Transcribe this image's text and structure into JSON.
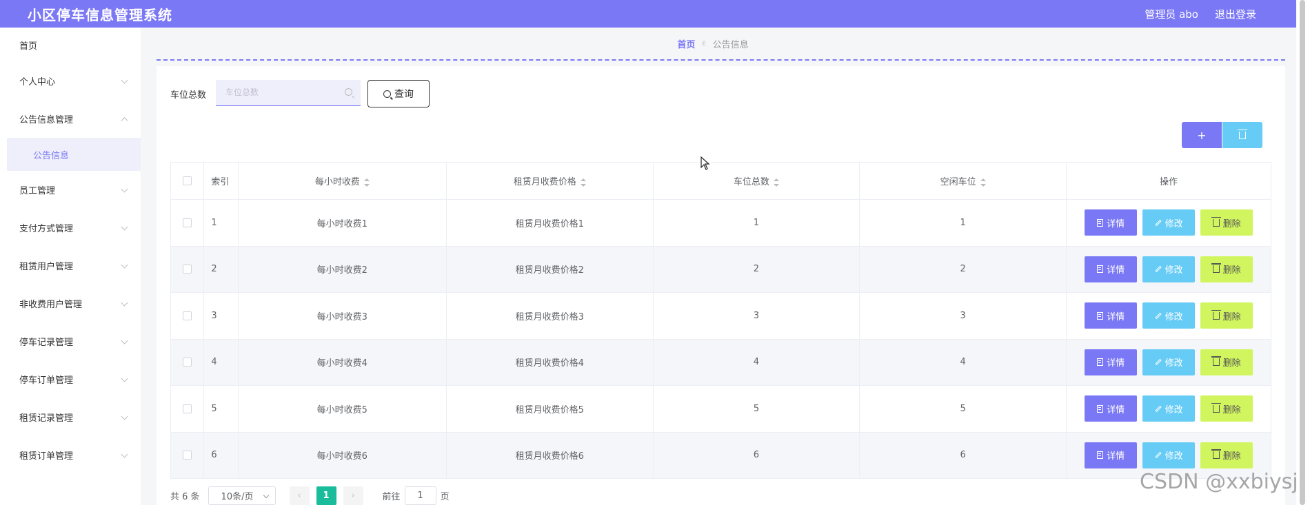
{
  "app": {
    "title": "小区停车信息管理系统",
    "admin_label": "管理员 abo",
    "logout_label": "退出登录"
  },
  "sidebar": {
    "items": [
      {
        "label": "首页"
      },
      {
        "label": "个人中心"
      },
      {
        "label": "公告信息管理",
        "expanded": true,
        "children": [
          {
            "label": "公告信息",
            "active": true
          }
        ]
      },
      {
        "label": "员工管理"
      },
      {
        "label": "支付方式管理"
      },
      {
        "label": "租赁用户管理"
      },
      {
        "label": "非收费用户管理"
      },
      {
        "label": "停车记录管理"
      },
      {
        "label": "停车订单管理"
      },
      {
        "label": "租赁记录管理"
      },
      {
        "label": "租赁订单管理"
      }
    ]
  },
  "breadcrumb": {
    "home": "首页",
    "current": "公告信息"
  },
  "search": {
    "label": "车位总数",
    "placeholder": "车位总数",
    "value": "",
    "button_label": "查询"
  },
  "toolbar": {
    "add_label": "+",
    "add_icon": "plus-icon",
    "delete_icon": "trash-icon"
  },
  "table": {
    "columns": [
      "索引",
      "每小时收费",
      "租赁月收费价格",
      "车位总数",
      "空闲车位",
      "操作"
    ],
    "rows": [
      {
        "index": "1",
        "hourly_fee": "每小时收费1",
        "monthly_price": "租赁月收费价格1",
        "total_spaces": "1",
        "free_spaces": "1"
      },
      {
        "index": "2",
        "hourly_fee": "每小时收费2",
        "monthly_price": "租赁月收费价格2",
        "total_spaces": "2",
        "free_spaces": "2"
      },
      {
        "index": "3",
        "hourly_fee": "每小时收费3",
        "monthly_price": "租赁月收费价格3",
        "total_spaces": "3",
        "free_spaces": "3"
      },
      {
        "index": "4",
        "hourly_fee": "每小时收费4",
        "monthly_price": "租赁月收费价格4",
        "total_spaces": "4",
        "free_spaces": "4"
      },
      {
        "index": "5",
        "hourly_fee": "每小时收费5",
        "monthly_price": "租赁月收费价格5",
        "total_spaces": "5",
        "free_spaces": "5"
      },
      {
        "index": "6",
        "hourly_fee": "每小时收费6",
        "monthly_price": "租赁月收费价格6",
        "total_spaces": "6",
        "free_spaces": "6"
      }
    ],
    "actions": {
      "detail": "详情",
      "edit": "修改",
      "delete": "删除"
    }
  },
  "pagination": {
    "total": "共 6 条",
    "page_size": "10条/页",
    "prev": "‹",
    "current_page": "1",
    "next": "›",
    "goto_prefix": "前往",
    "goto_value": "1",
    "goto_suffix": "页"
  },
  "watermark": "CSDN @xxbiysj",
  "colors": {
    "primary": "#7b78f5",
    "info": "#66ccf6",
    "warning": "#d1f55f",
    "pager_active": "#1abc9c"
  }
}
